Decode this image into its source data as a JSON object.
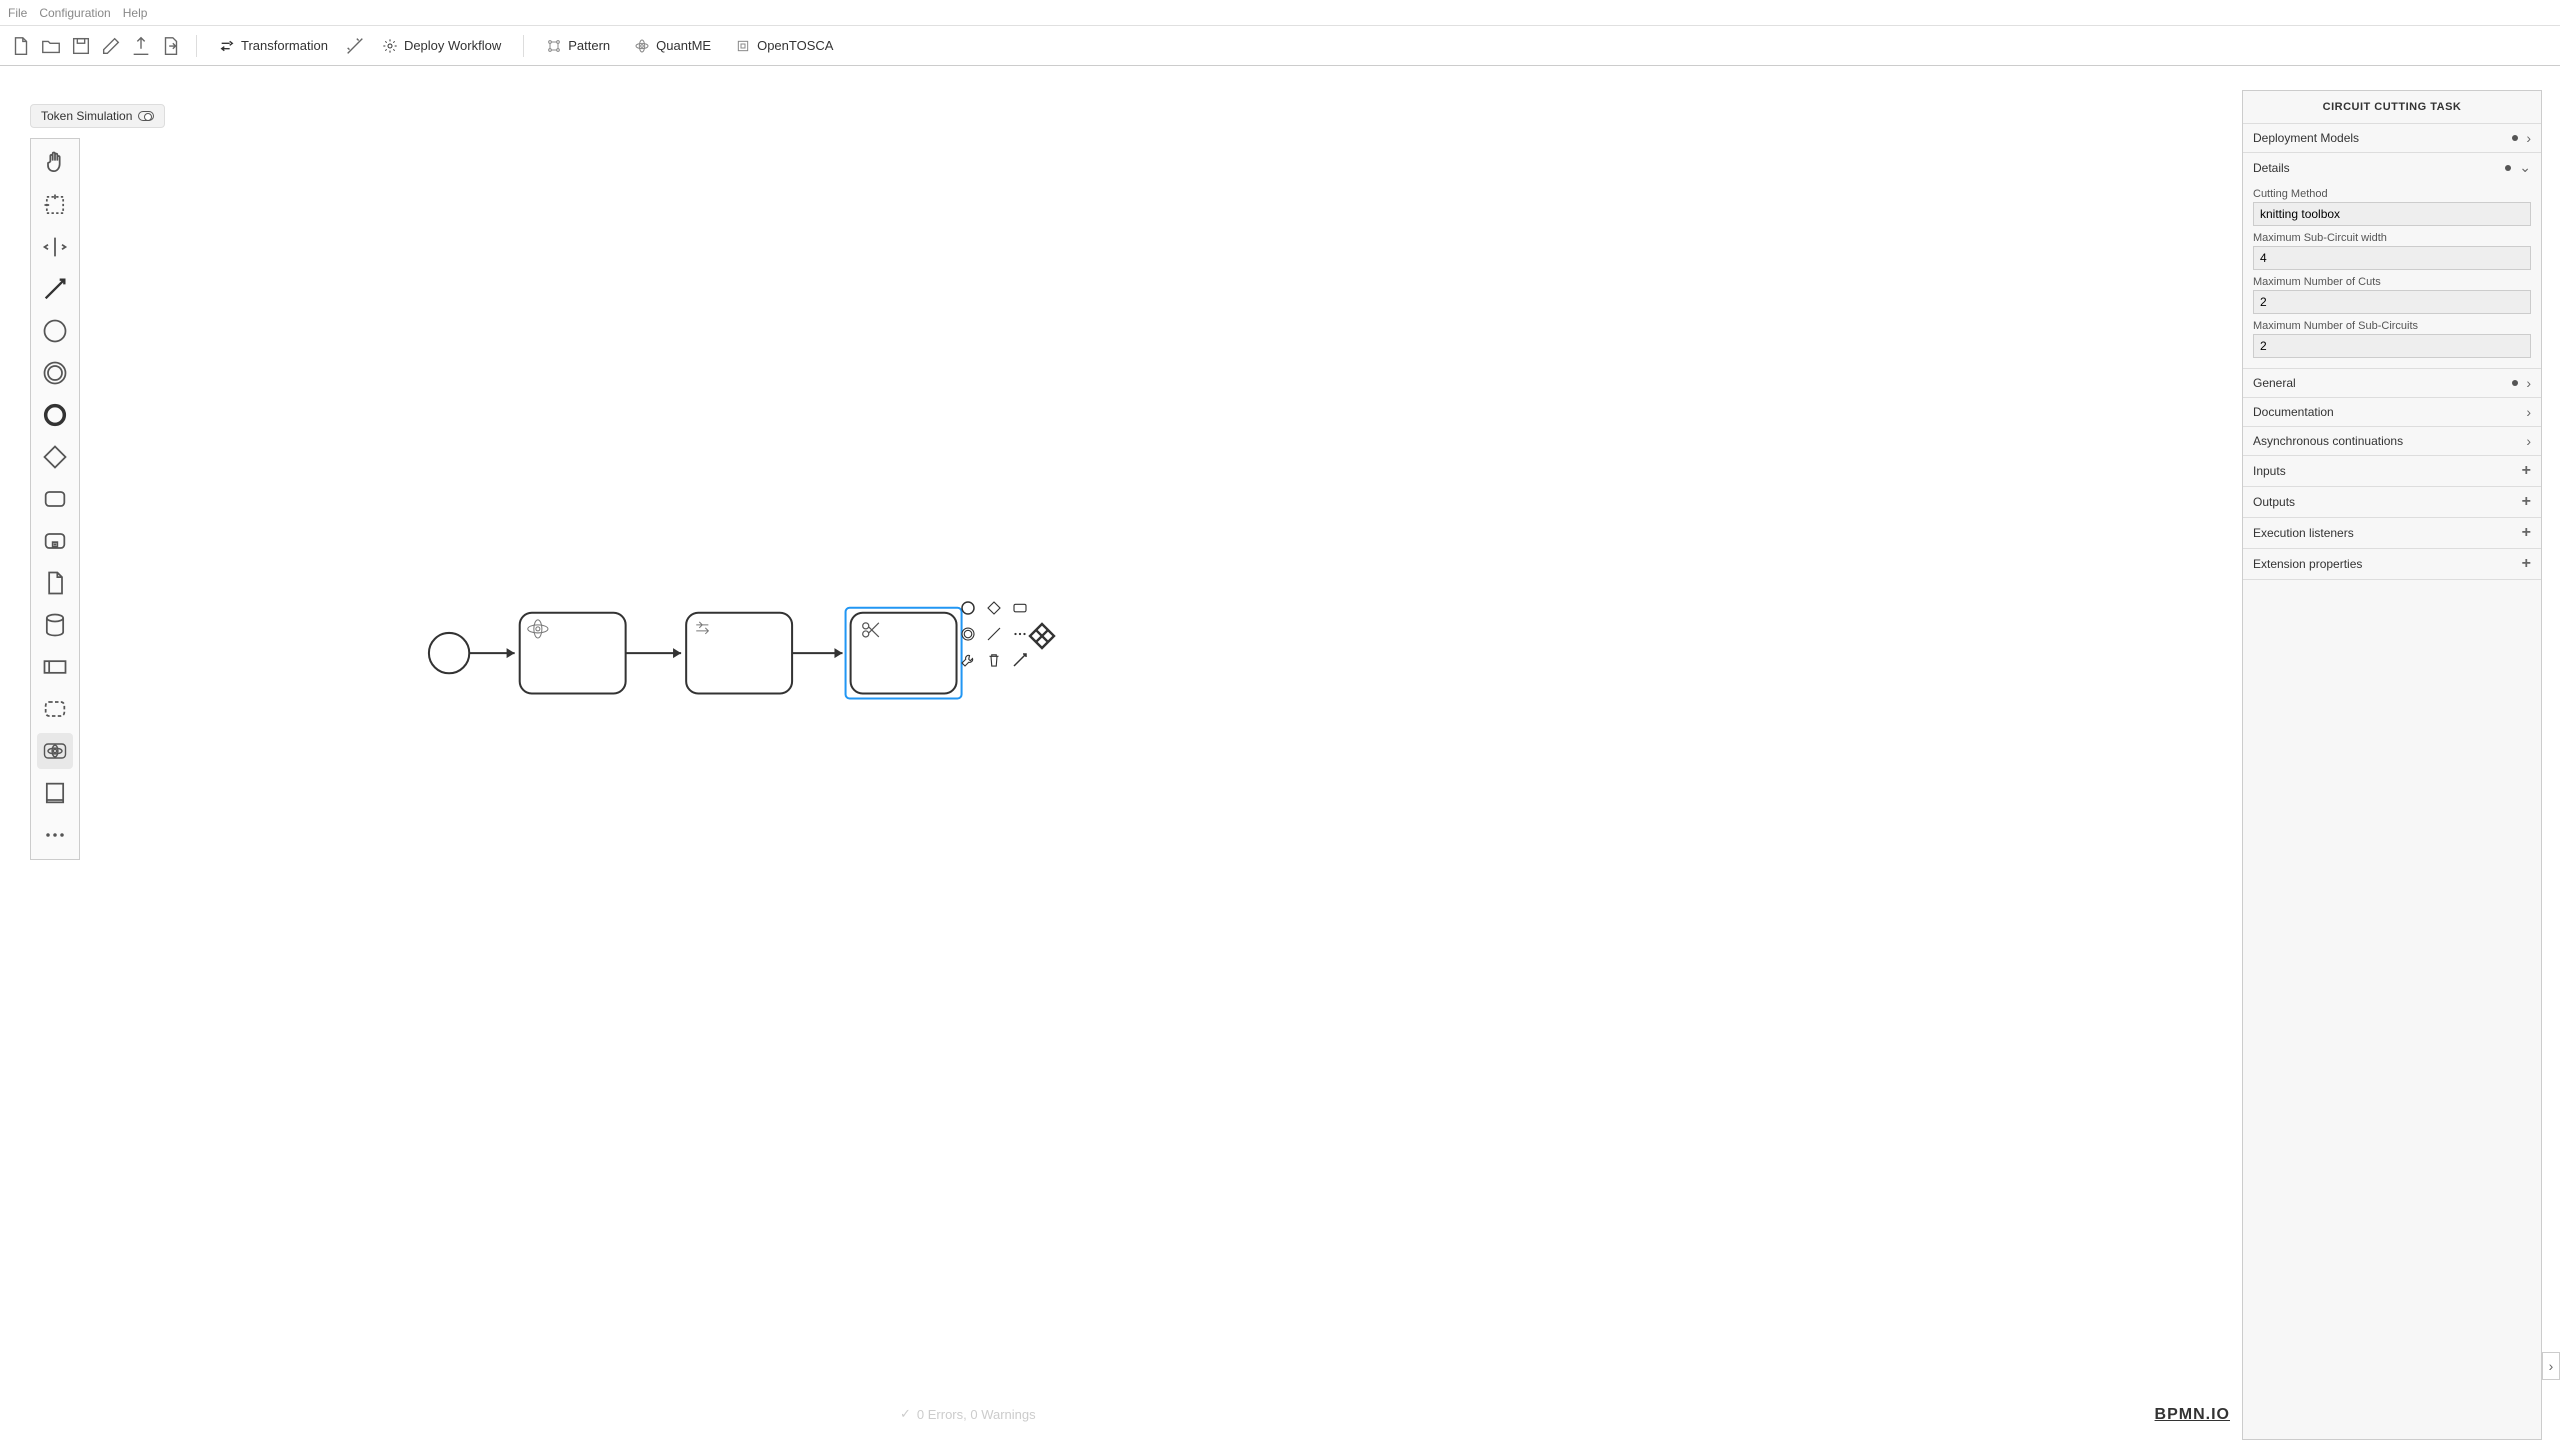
{
  "menu": {
    "file": "File",
    "config": "Configuration",
    "help": "Help"
  },
  "toolbar": {
    "transformation": "Transformation",
    "deploy": "Deploy Workflow",
    "pattern": "Pattern",
    "quantme": "QuantME",
    "opentosca": "OpenTOSCA"
  },
  "token_simulation": "Token Simulation",
  "properties": {
    "title": "CIRCUIT CUTTING TASK",
    "sections": {
      "deployment": "Deployment Models",
      "details": "Details",
      "general": "General",
      "documentation": "Documentation",
      "async": "Asynchronous continuations",
      "inputs": "Inputs",
      "outputs": "Outputs",
      "listeners": "Execution listeners",
      "ext": "Extension properties"
    },
    "fields": {
      "cutting_method_label": "Cutting Method",
      "cutting_method_value": "knitting toolbox",
      "max_width_label": "Maximum Sub-Circuit width",
      "max_width_value": "4",
      "max_cuts_label": "Maximum Number of Cuts",
      "max_cuts_value": "2",
      "max_subcircuits_label": "Maximum Number of Sub-Circuits",
      "max_subcircuits_value": "2"
    }
  },
  "footer": {
    "status": "0 Errors, 0 Warnings",
    "brand": "BPMN.IO"
  }
}
